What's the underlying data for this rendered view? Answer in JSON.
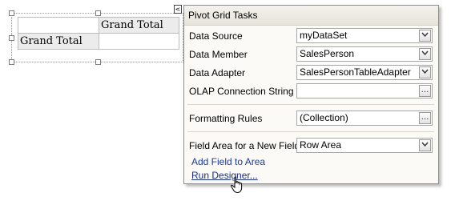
{
  "pivot_grid": {
    "column_header": "Grand Total",
    "row_header": "Grand Total"
  },
  "smart_tag": {
    "glyph": "<"
  },
  "tasks_panel": {
    "title": "Pivot Grid Tasks",
    "rows": [
      {
        "label": "Data Source",
        "value": "myDataSet",
        "control": "dropdown",
        "button_glyph": "v"
      },
      {
        "label": "Data Member",
        "value": "SalesPerson",
        "control": "dropdown",
        "button_glyph": "v"
      },
      {
        "label": "Data Adapter",
        "value": "SalesPersonTableAdapter",
        "control": "dropdown",
        "button_glyph": "v"
      },
      {
        "label": "OLAP Connection String",
        "value": "",
        "control": "ellipsis",
        "button_glyph": "..."
      },
      {
        "label": "Formatting Rules",
        "value": "(Collection)",
        "control": "ellipsis",
        "button_glyph": "..."
      },
      {
        "label": "Field Area for a New Field",
        "value": "Row Area",
        "control": "dropdown",
        "button_glyph": "v"
      }
    ],
    "links": {
      "add_field": "Add Field to Area",
      "run_designer": "Run Designer..."
    }
  },
  "icons": {
    "dropdown_arrow": "chevron-down-icon",
    "ellipsis": "ellipsis-icon",
    "cursor": "hand-cursor-icon"
  },
  "colors": {
    "panel_background": "#fbfaf6",
    "header_cell": "#ececec",
    "link": "#1f3a93"
  }
}
